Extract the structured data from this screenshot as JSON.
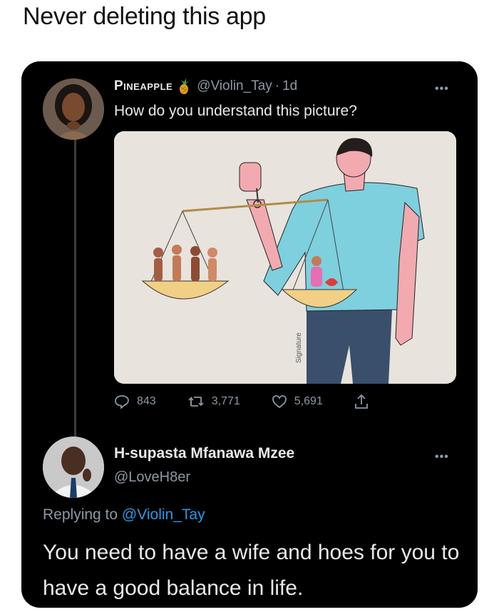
{
  "caption": "Never deleting this app",
  "tweet": {
    "display_name": "Pineapple",
    "emoji_icon": "pineapple-icon",
    "handle": "@Violin_Tay",
    "separator": "·",
    "time": "1d",
    "text": "How do you understand this picture?",
    "more_icon": "more-dots-icon",
    "image_signature": "Signature",
    "stats": {
      "replies": "843",
      "retweets": "3,771",
      "likes": "5,691"
    }
  },
  "reply": {
    "display_name": "H-supasta Mfanawa Mzee",
    "handle": "@LoveH8er",
    "replying_prefix": "Replying to",
    "replying_to": "@Violin_Tay",
    "text": "You need to have a wife and hoes for you to have a good balance in life."
  },
  "colors": {
    "card_bg": "#000000",
    "text_primary": "#e7e9ea",
    "text_secondary": "#8b98a5",
    "link": "#1d9bf0"
  }
}
